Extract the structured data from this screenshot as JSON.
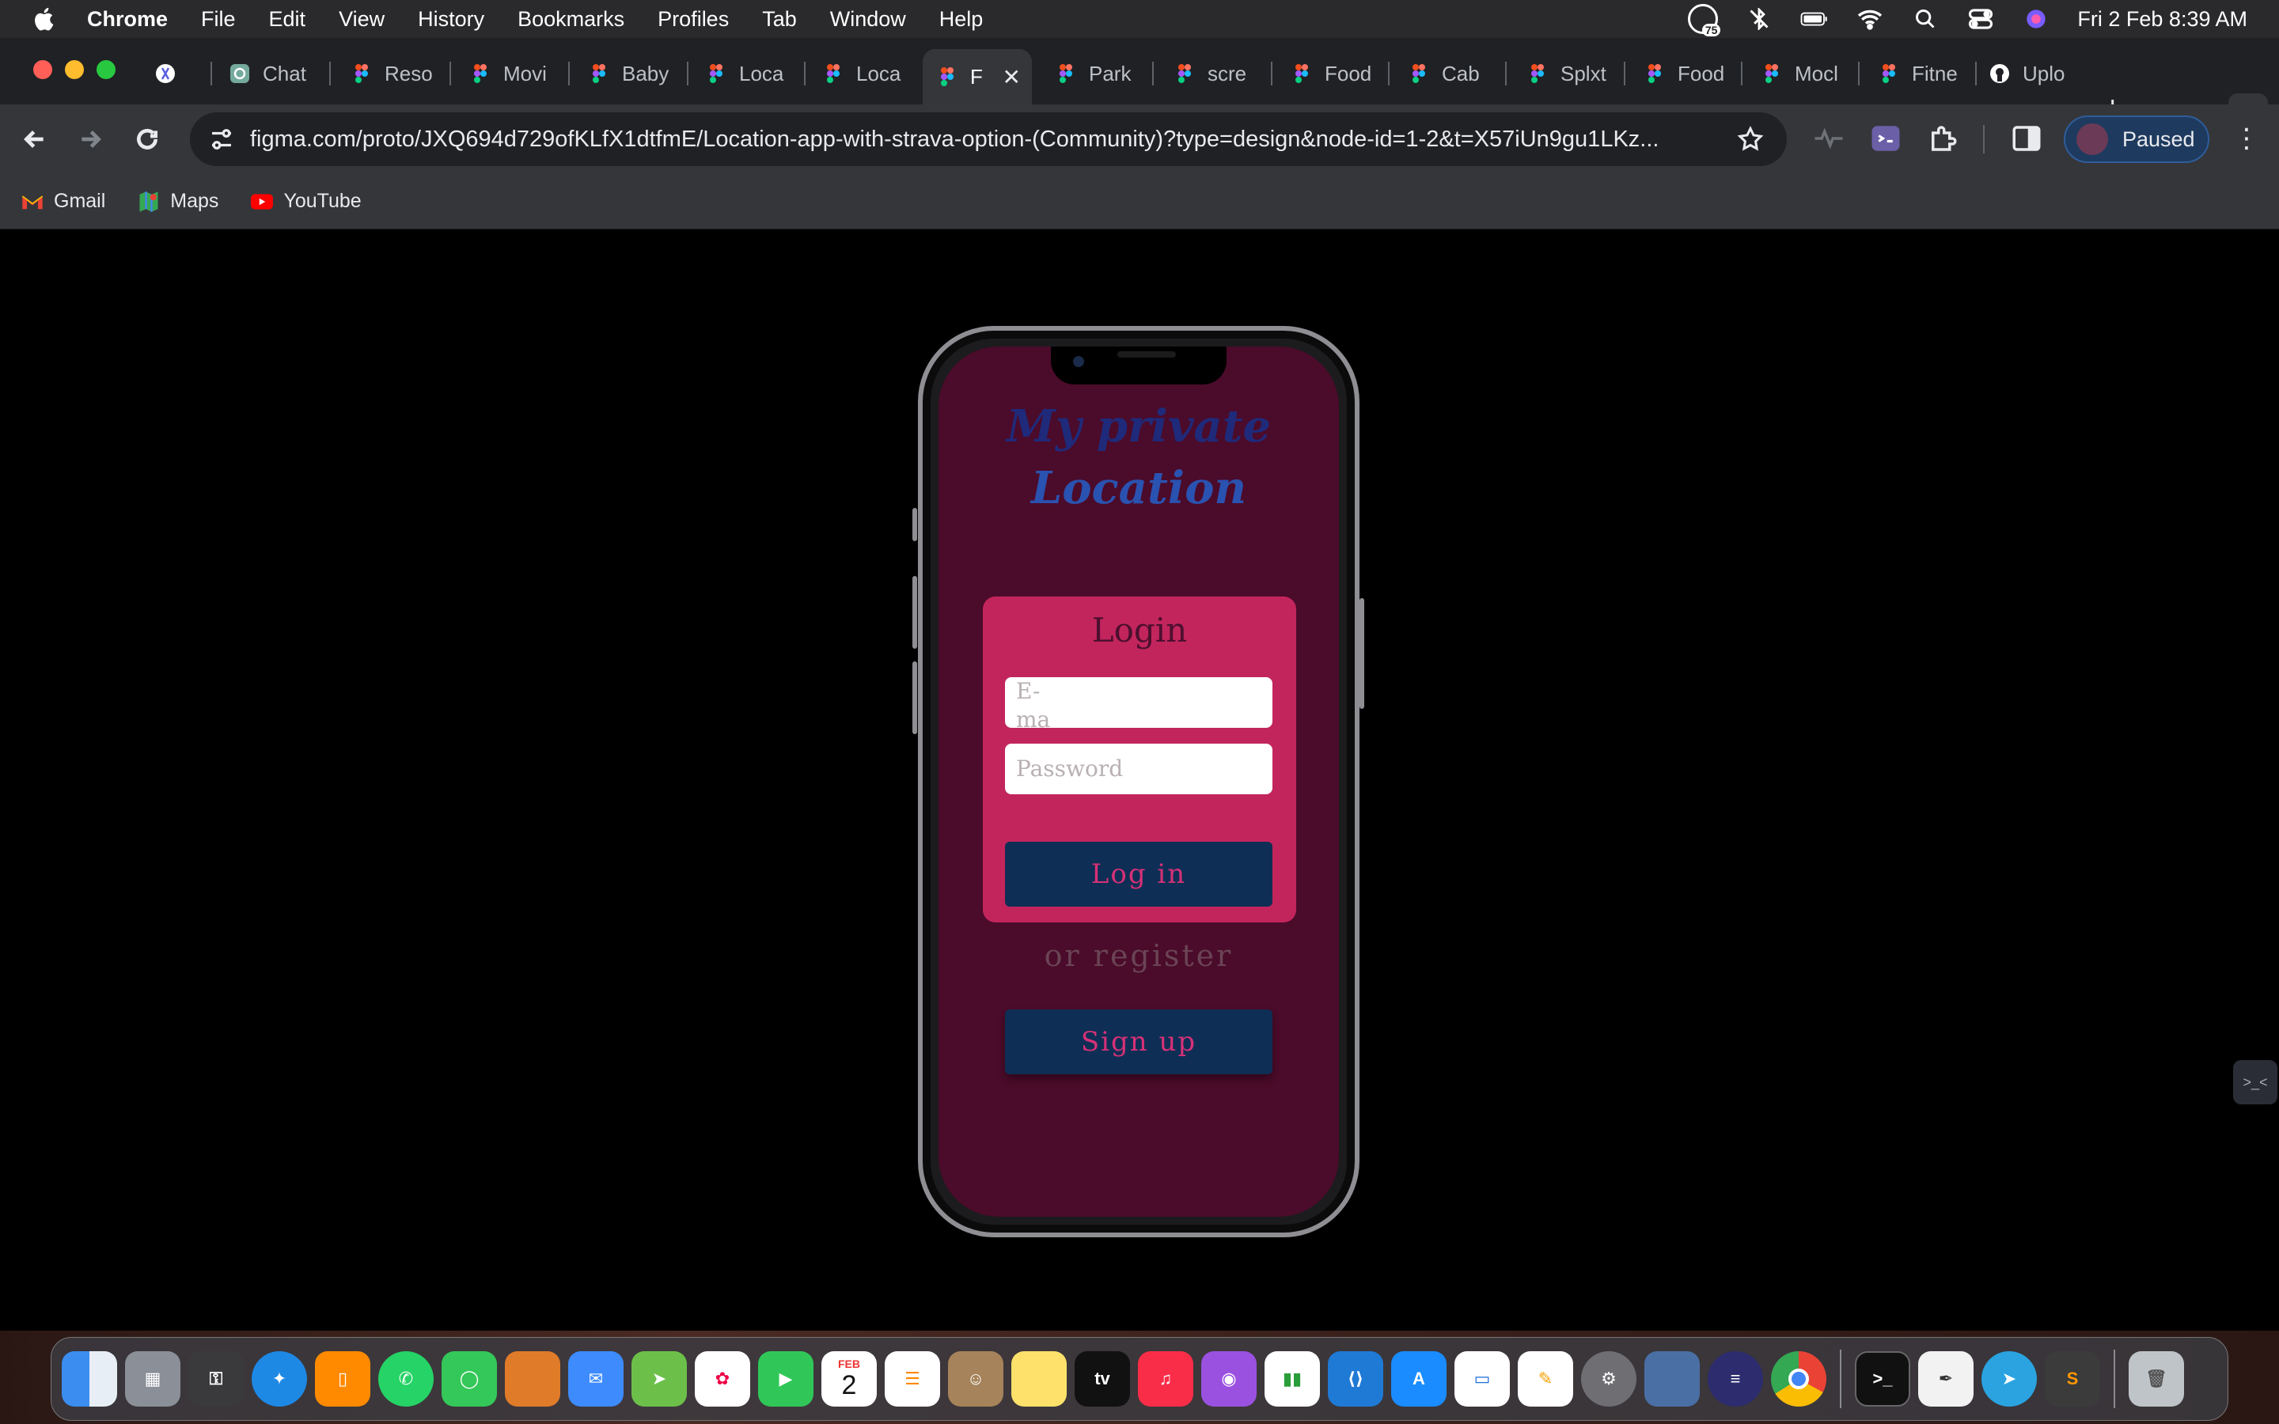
{
  "menubar": {
    "app_name": "Chrome",
    "items": [
      "File",
      "Edit",
      "View",
      "History",
      "Bookmarks",
      "Profiles",
      "Tab",
      "Window",
      "Help"
    ],
    "notification_count": "75",
    "datetime": "Fri 2 Feb  8:39 AM"
  },
  "tabs": [
    {
      "title": "",
      "icon": "perplexity-icon"
    },
    {
      "title": "Chat",
      "icon": "chatgpt-icon"
    },
    {
      "title": "Reso",
      "icon": "figma-icon"
    },
    {
      "title": "Movi",
      "icon": "figma-icon"
    },
    {
      "title": "Baby",
      "icon": "figma-icon"
    },
    {
      "title": "Loca",
      "icon": "figma-icon"
    },
    {
      "title": "Loca",
      "icon": "figma-icon"
    },
    {
      "title": "F",
      "icon": "figma-icon",
      "active": true
    },
    {
      "title": "Park",
      "icon": "figma-icon"
    },
    {
      "title": "scre",
      "icon": "figma-icon"
    },
    {
      "title": "Food",
      "icon": "figma-icon"
    },
    {
      "title": "Cab",
      "icon": "figma-icon"
    },
    {
      "title": "Splxt",
      "icon": "figma-icon"
    },
    {
      "title": "Food",
      "icon": "figma-icon"
    },
    {
      "title": "Mocl",
      "icon": "figma-icon"
    },
    {
      "title": "Fitne",
      "icon": "figma-icon"
    },
    {
      "title": "Uplo",
      "icon": "github-icon"
    }
  ],
  "toolbar": {
    "url": "figma.com/proto/JXQ694d729ofKLfX1dtfmE/Location-app-with-strava-option-(Community)?type=design&node-id=1-2&t=X57iUn9gu1LKz...",
    "profile_label": "Paused"
  },
  "bookmarks": [
    {
      "label": "Gmail",
      "icon": "gmail-icon"
    },
    {
      "label": "Maps",
      "icon": "maps-icon"
    },
    {
      "label": "YouTube",
      "icon": "youtube-icon"
    }
  ],
  "app": {
    "title_line1": "My private",
    "title_line2": "Location",
    "login_heading": "Login",
    "email_placeholder": "E-mail",
    "password_placeholder": "Password",
    "login_button": "Log  in",
    "or_register": "or  register",
    "signup_button": "Sign  up"
  },
  "dock": {
    "calendar_month": "FEB",
    "calendar_day": "2",
    "apps": [
      "finder-icon",
      "launchpad-icon",
      "keychain-icon",
      "safari-icon",
      "books-icon",
      "whatsapp-icon",
      "messages-icon",
      "preview-icon",
      "mail-icon",
      "maps-icon",
      "photos-icon",
      "facetime-icon",
      "calendar-icon",
      "reminders-icon",
      "contacts-icon",
      "notes-icon",
      "appletv-icon",
      "music-icon",
      "podcasts-icon",
      "numbers-icon",
      "vscode-icon",
      "appstore-icon",
      "keynote-icon",
      "pages-icon",
      "system-settings-icon",
      "preview2-icon",
      "instruments-icon",
      "chrome-icon",
      "terminal-icon",
      "textedit-icon",
      "telegram-icon",
      "sublime-icon",
      "trash-icon"
    ]
  },
  "colors": {
    "screen_bg": "#4b0b2a",
    "card_bg": "#c2255c",
    "button_bg": "#0f2e55",
    "button_text": "#d63177",
    "title_color": "#1f2a7a"
  }
}
